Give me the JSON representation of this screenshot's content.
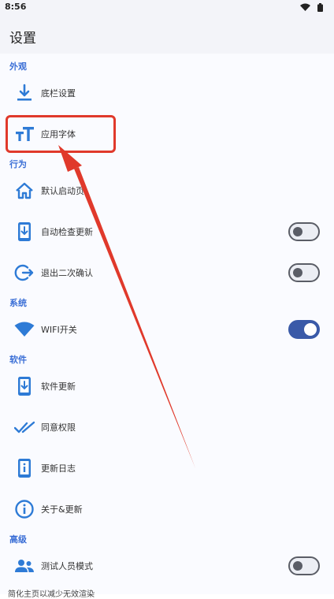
{
  "status": {
    "time": "8:56"
  },
  "appbar": {
    "title": "设置"
  },
  "sections": {
    "appearance": "外观",
    "behavior": "行为",
    "system": "系统",
    "software": "软件",
    "advanced": "高级"
  },
  "items": {
    "bottom_bar": "底栏设置",
    "app_font": "应用字体",
    "default_launch_page": "默认启动页",
    "auto_check_update": "自动检查更新",
    "exit_confirm": "退出二次确认",
    "wifi_switch": "WIFI开关",
    "software_update": "软件更新",
    "agree_permission": "同意权限",
    "update_log": "更新日志",
    "about_update": "关于&更新",
    "tester_mode": "测试人员模式"
  },
  "toggles": {
    "auto_check_update": false,
    "exit_confirm": false,
    "wifi_switch": true,
    "tester_mode": false
  },
  "footer": {
    "text": "简化主页以减少无效渲染"
  },
  "colors": {
    "accent": "#3a5aa8",
    "section_label": "#3b6fd6",
    "icon_blue": "#2e7bd6",
    "annotation_red": "#e0392b"
  }
}
